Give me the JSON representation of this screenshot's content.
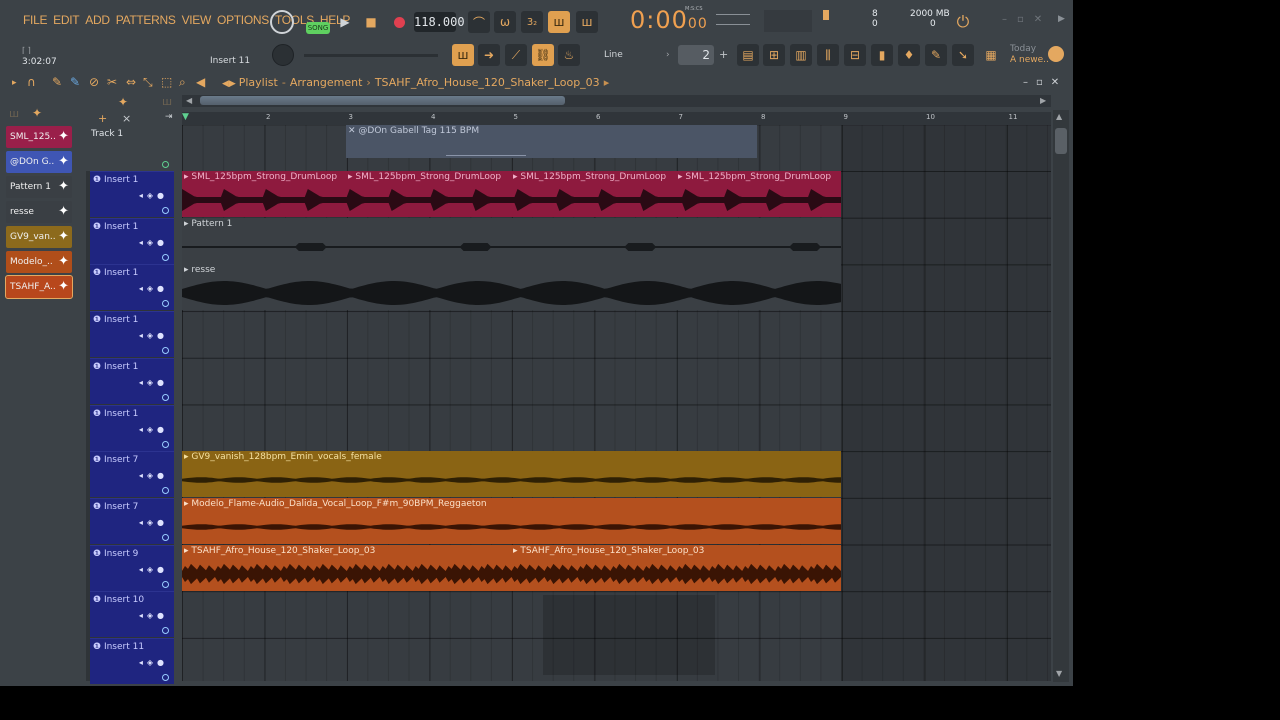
{
  "menu": [
    "FILE",
    "EDIT",
    "ADD",
    "PATTERNS",
    "VIEW",
    "OPTIONS",
    "TOOLS",
    "HELP"
  ],
  "transport": {
    "mode_label": "SONG",
    "tempo": "118.000",
    "time_main": "0:00",
    "time_sub": "00",
    "time_unit": "M:S:CS"
  },
  "status": {
    "song_position": "3:02:07",
    "insert": "Insert 11",
    "cpu_value": "8",
    "cpu_value2": "0",
    "memory": "2000 MB",
    "memory2": "0"
  },
  "news": {
    "line1": "Today",
    "line2": "A newe.."
  },
  "snap": {
    "mode": "Line",
    "value": "2"
  },
  "playlist": {
    "title": "Playlist",
    "section": "Arrangement",
    "clip_name": "TSAHF_Afro_House_120_Shaker_Loop_03"
  },
  "picker": [
    {
      "label": "SML_125..",
      "color": "#9a1f4a"
    },
    {
      "label": "@DOn G..",
      "color": "#3f56b4"
    },
    {
      "label": "Pattern 1",
      "color": "#3a3f44"
    },
    {
      "label": "resse",
      "color": "#3a3f44"
    },
    {
      "label": "GV9_van..",
      "color": "#8c6a1c"
    },
    {
      "label": "Modelo_..",
      "color": "#b04e1a"
    },
    {
      "label": "TSAHF_A..",
      "color": "#b8471c"
    }
  ],
  "ruler": [
    "2",
    "3",
    "4",
    "5",
    "6",
    "7",
    "8",
    "9",
    "10",
    "11"
  ],
  "track1": {
    "name": "Track 1",
    "clip": "@DOn Gabell Tag 115 BPM"
  },
  "tracks": [
    {
      "name": "Insert 1"
    },
    {
      "name": "Insert 1"
    },
    {
      "name": "Insert 1"
    },
    {
      "name": "Insert 1"
    },
    {
      "name": "Insert 1"
    },
    {
      "name": "Insert 1"
    },
    {
      "name": "Insert 7"
    },
    {
      "name": "Insert 7"
    },
    {
      "name": "Insert 9"
    },
    {
      "name": "Insert 10"
    },
    {
      "name": "Insert 11"
    }
  ],
  "clips": {
    "drum": "SML_125bpm_Strong_DrumLoop",
    "pattern": "Pattern 1",
    "resse": "resse",
    "vocal1": "GV9_vanish_128bpm_Emin_vocals_female",
    "vocal2": "Modelo_Flame-Audio_Dalida_Vocal_Loop_F#m_90BPM_Reggaeton",
    "shaker": "TSAHF_Afro_House_120_Shaker_Loop_03"
  },
  "colors": {
    "accent": "#e4a860",
    "track_header": "#1f2580",
    "drum_clip": "#8e1a3e",
    "vocal_clip": "#8a6414",
    "orange_clip": "#b4501e"
  }
}
